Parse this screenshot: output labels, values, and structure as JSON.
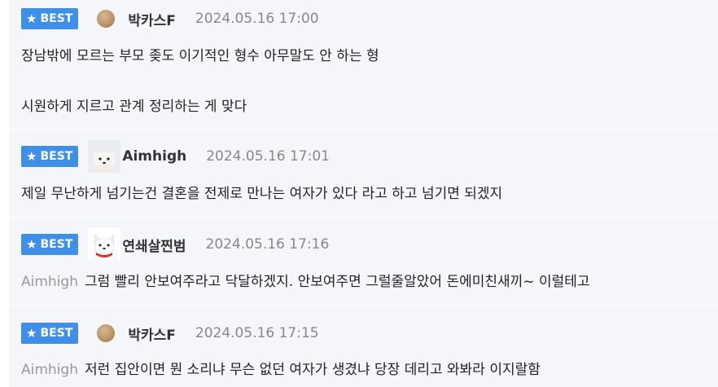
{
  "comments": [
    {
      "badge": "BEST",
      "author": "박카스F",
      "date": "2024.05.16 17:00",
      "lines": [
        "장남밖에 모르는 부모 좆도 이기적인 형수 아무말도 안 하는 형",
        "시원하게 지르고 관계 정리하는 게 맞다"
      ]
    },
    {
      "badge": "BEST",
      "author": "Aimhigh",
      "date": "2024.05.16 17:01",
      "lines": [
        "제일 무난하게 넘기는건 결혼을 전제로 만나는 여자가 있다 라고 하고 넘기면 되겠지"
      ]
    },
    {
      "badge": "BEST",
      "author": "연쇄살찐범",
      "date": "2024.05.16 17:16",
      "mention": "Aimhigh",
      "lines": [
        "그럼 빨리 안보여주라고 닥달하겠지. 안보여주면 그럴줄알았어 돈에미친새끼~ 이럴테고"
      ]
    },
    {
      "badge": "BEST",
      "author": "박카스F",
      "date": "2024.05.16 17:15",
      "mention": "Aimhigh",
      "lines": [
        "저런 집안이면 뭔 소리냐 무슨 없던 여자가 생겼냐 당장 데리고 와봐라 이지랄함"
      ]
    }
  ],
  "colors": {
    "badge": "#3f8fe8",
    "card_bg": "#f5f6fa",
    "mention": "#999999",
    "date": "#888888"
  },
  "icons": {
    "badge_icon": "star-icon"
  }
}
